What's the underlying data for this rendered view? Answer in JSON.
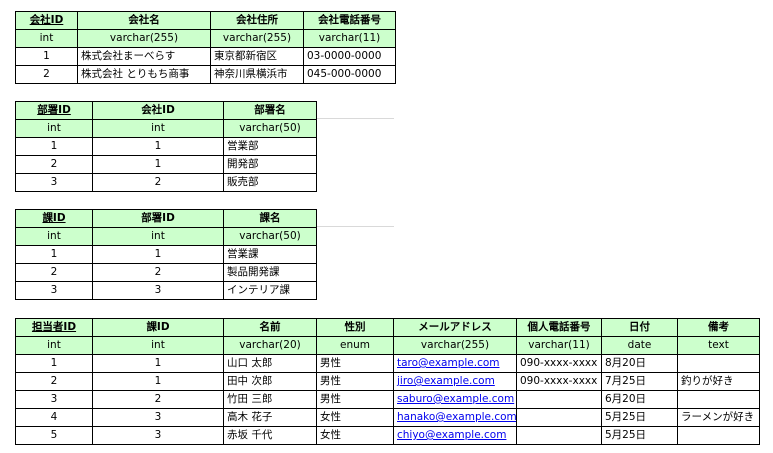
{
  "company": {
    "headers": [
      "会社ID",
      "会社名",
      "会社住所",
      "会社電話番号"
    ],
    "types": [
      "int",
      "varchar(255)",
      "varchar(255)",
      "varchar(11)"
    ],
    "rows": [
      [
        "1",
        "株式会社まーべらす",
        "東京都新宿区",
        "03-0000-0000"
      ],
      [
        "2",
        "株式会社 とりもち商事",
        "神奈川県横浜市",
        "045-000-0000"
      ]
    ]
  },
  "department": {
    "headers": [
      "部署ID",
      "会社ID",
      "部署名"
    ],
    "types": [
      "int",
      "int",
      "varchar(50)"
    ],
    "rows": [
      [
        "1",
        "1",
        "営業部"
      ],
      [
        "2",
        "1",
        "開発部"
      ],
      [
        "3",
        "2",
        "販売部"
      ]
    ]
  },
  "section": {
    "headers": [
      "課ID",
      "部署ID",
      "課名"
    ],
    "types": [
      "int",
      "int",
      "varchar(50)"
    ],
    "rows": [
      [
        "1",
        "1",
        "営業課"
      ],
      [
        "2",
        "2",
        "製品開発課"
      ],
      [
        "3",
        "3",
        "インテリア課"
      ]
    ]
  },
  "staff": {
    "headers": [
      "担当者ID",
      "課ID",
      "名前",
      "性別",
      "メールアドレス",
      "個人電話番号",
      "日付",
      "備考"
    ],
    "types": [
      "int",
      "int",
      "varchar(20)",
      "enum",
      "varchar(255)",
      "varchar(11)",
      "date",
      "text"
    ],
    "rows": [
      [
        "1",
        "1",
        "山口 太郎",
        "男性",
        "taro@example.com",
        "090-xxxx-xxxx",
        "8月20日",
        ""
      ],
      [
        "2",
        "1",
        "田中 次郎",
        "男性",
        "jiro@example.com",
        "090-xxxx-xxxx",
        "7月25日",
        "釣りが好き"
      ],
      [
        "3",
        "2",
        "竹田 三郎",
        "男性",
        "saburo@example.com",
        "",
        "6月20日",
        ""
      ],
      [
        "4",
        "3",
        "高木 花子",
        "女性",
        "hanako@example.com",
        "",
        "5月25日",
        "ラーメンが好き"
      ],
      [
        "5",
        "3",
        "赤坂 千代",
        "女性",
        "chiyo@example.com",
        "",
        "5月25日",
        ""
      ]
    ]
  }
}
